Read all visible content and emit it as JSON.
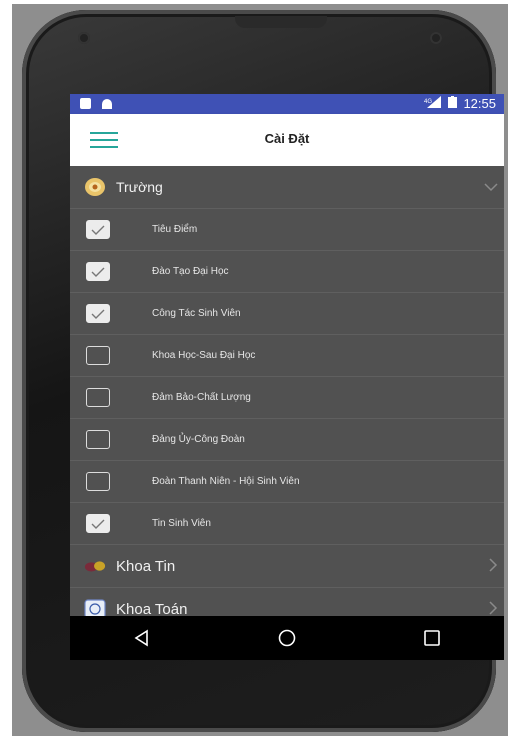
{
  "status_bar": {
    "time": "12:55",
    "network": "4G",
    "left_icons": [
      "notification-icon",
      "android-icon"
    ]
  },
  "app_bar": {
    "title": "Cài Đặt",
    "menu_icon": "hamburger-menu-icon",
    "accent_color": "#26a69a"
  },
  "groups": [
    {
      "label": "Trường",
      "icon": "school-logo-icon",
      "expanded": true,
      "items": [
        {
          "label": "Tiêu Điểm",
          "checked": true
        },
        {
          "label": "Đào Tạo Đại Học",
          "checked": true
        },
        {
          "label": "Công Tác Sinh Viên",
          "checked": true
        },
        {
          "label": "Khoa Học-Sau Đại Học",
          "checked": false
        },
        {
          "label": "Đảm Bảo-Chất Lượng",
          "checked": false
        },
        {
          "label": "Đảng Ủy-Công Đoàn",
          "checked": false
        },
        {
          "label": "Đoàn Thanh Niên - Hội Sinh Viên",
          "checked": false
        },
        {
          "label": "Tin Sinh Viên",
          "checked": true
        }
      ]
    },
    {
      "label": "Khoa Tin",
      "icon": "faculty-it-logo-icon",
      "expanded": false
    },
    {
      "label": "Khoa Toán",
      "icon": "faculty-math-logo-icon",
      "expanded": false
    }
  ],
  "nav_bar": [
    "back-icon",
    "home-icon",
    "recents-icon"
  ],
  "colors": {
    "status_bar": "#3f51b5",
    "list_bg": "#515151",
    "divider": "#5f5f5f"
  }
}
